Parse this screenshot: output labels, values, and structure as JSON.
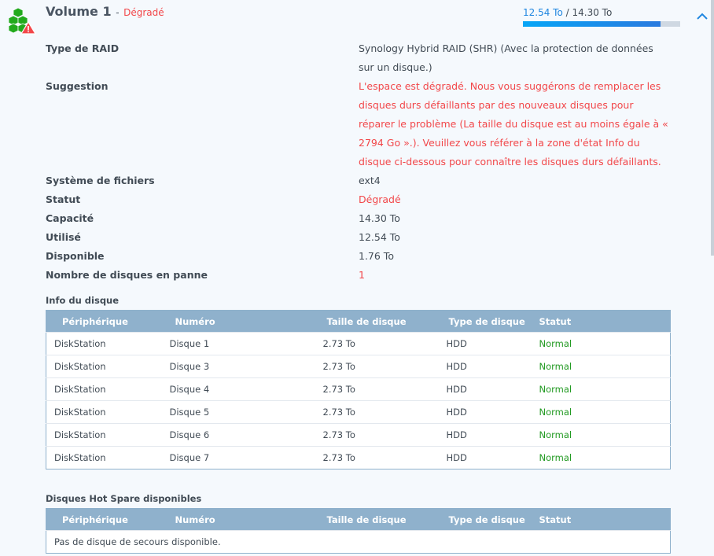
{
  "volume": {
    "title": "Volume 1",
    "separator": "-",
    "status": "Dégradé",
    "used": "12.54 To",
    "total": "/ 14.30 To",
    "usage_percent": 87.7,
    "icon": "volume-degraded-icon",
    "collapse_icon": "chevron-up-icon"
  },
  "properties": [
    {
      "label": "Type de RAID",
      "value": "Synology Hybrid RAID (SHR) (Avec la protection de données sur un disque.)"
    },
    {
      "label": "Suggestion",
      "value": "L'espace est dégradé. Nous vous suggérons de remplacer les disques durs défaillants par des nouveaux disques pour réparer le problème (La taille du disque est au moins égale à « 2794 Go ».). Veuillez vous référer à la zone d'état Info du disque ci-dessous pour connaître les disques durs défaillants."
    },
    {
      "label": "Système de fichiers",
      "value": "ext4"
    },
    {
      "label": "Statut",
      "value": "Dégradé"
    },
    {
      "label": "Capacité",
      "value": "14.30 To"
    },
    {
      "label": "Utilisé",
      "value": "12.54 To"
    },
    {
      "label": "Disponible",
      "value": "1.76 To"
    },
    {
      "label": "Nombre de disques en panne",
      "value": "1"
    }
  ],
  "disk_info": {
    "title": "Info du disque",
    "columns": [
      "Périphérique",
      "Numéro",
      "Taille de disque",
      "Type de disque",
      "Statut"
    ],
    "rows": [
      [
        "DiskStation",
        "Disque 1",
        "2.73 To",
        "HDD",
        "Normal"
      ],
      [
        "DiskStation",
        "Disque 3",
        "2.73 To",
        "HDD",
        "Normal"
      ],
      [
        "DiskStation",
        "Disque 4",
        "2.73 To",
        "HDD",
        "Normal"
      ],
      [
        "DiskStation",
        "Disque 5",
        "2.73 To",
        "HDD",
        "Normal"
      ],
      [
        "DiskStation",
        "Disque 6",
        "2.73 To",
        "HDD",
        "Normal"
      ],
      [
        "DiskStation",
        "Disque 7",
        "2.73 To",
        "HDD",
        "Normal"
      ]
    ]
  },
  "hot_spare": {
    "title": "Disques Hot Spare disponibles",
    "columns": [
      "Périphérique",
      "Numéro",
      "Taille de disque",
      "Type de disque",
      "Statut"
    ],
    "empty": "Pas de disque de secours disponible."
  },
  "colors": {
    "accent": "#1f86e0",
    "danger": "#f2474a",
    "ok": "#229a22",
    "table_header": "#8fb1cc"
  }
}
